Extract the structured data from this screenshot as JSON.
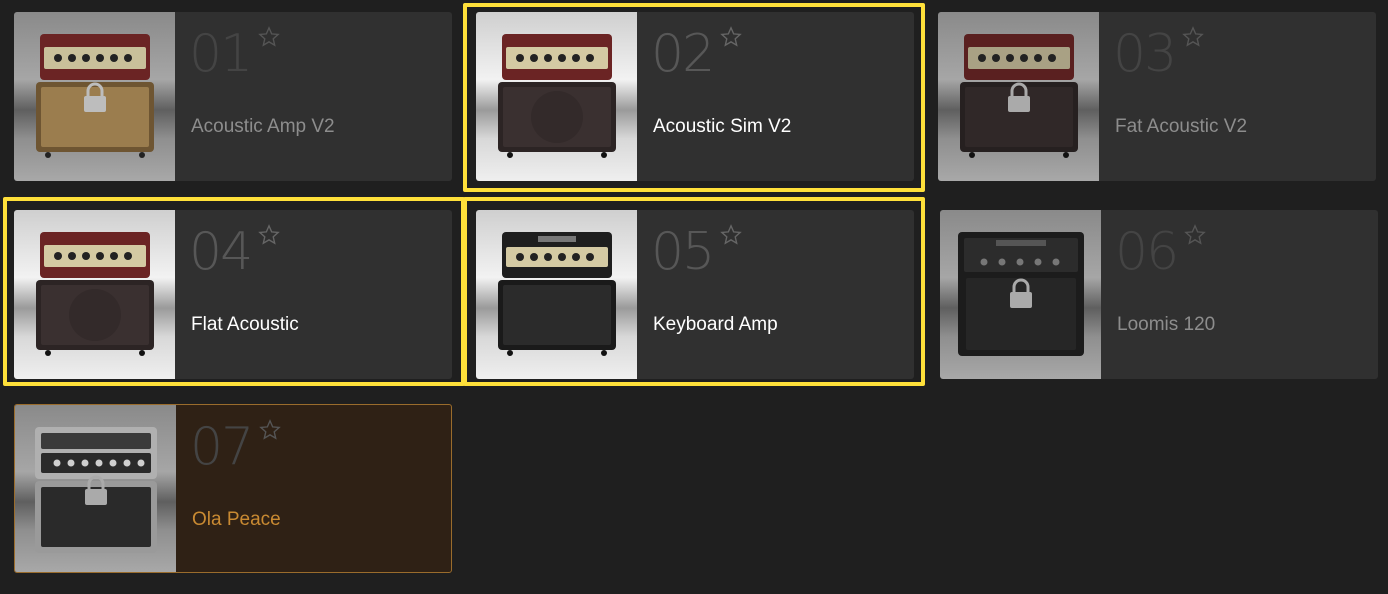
{
  "presets": [
    {
      "number": "01",
      "name": "Acoustic Amp V2",
      "locked": true,
      "selected": false,
      "amp_style": "red-head-tan-cab"
    },
    {
      "number": "02",
      "name": "Acoustic Sim V2",
      "locked": false,
      "selected": false,
      "amp_style": "red-head-dark-cab"
    },
    {
      "number": "03",
      "name": "Fat Acoustic V2",
      "locked": true,
      "selected": false,
      "amp_style": "red-head-dark-cab"
    },
    {
      "number": "04",
      "name": "Flat Acoustic",
      "locked": false,
      "selected": false,
      "amp_style": "red-head-dark-cab"
    },
    {
      "number": "05",
      "name": "Keyboard Amp",
      "locked": false,
      "selected": false,
      "amp_style": "black-head-grille-cab"
    },
    {
      "number": "06",
      "name": "Loomis 120",
      "locked": true,
      "selected": false,
      "amp_style": "combo-black"
    },
    {
      "number": "07",
      "name": "Ola Peace",
      "locked": true,
      "selected": true,
      "amp_style": "silver-head-grille-cab"
    }
  ],
  "colors": {
    "card_bg": "#303030",
    "selected_bg": "#2f2115",
    "selected_accent": "#c98a32",
    "highlight": "#ffe03a"
  },
  "icons": {
    "favorite": "star-outline-icon",
    "lock": "lock-icon"
  }
}
